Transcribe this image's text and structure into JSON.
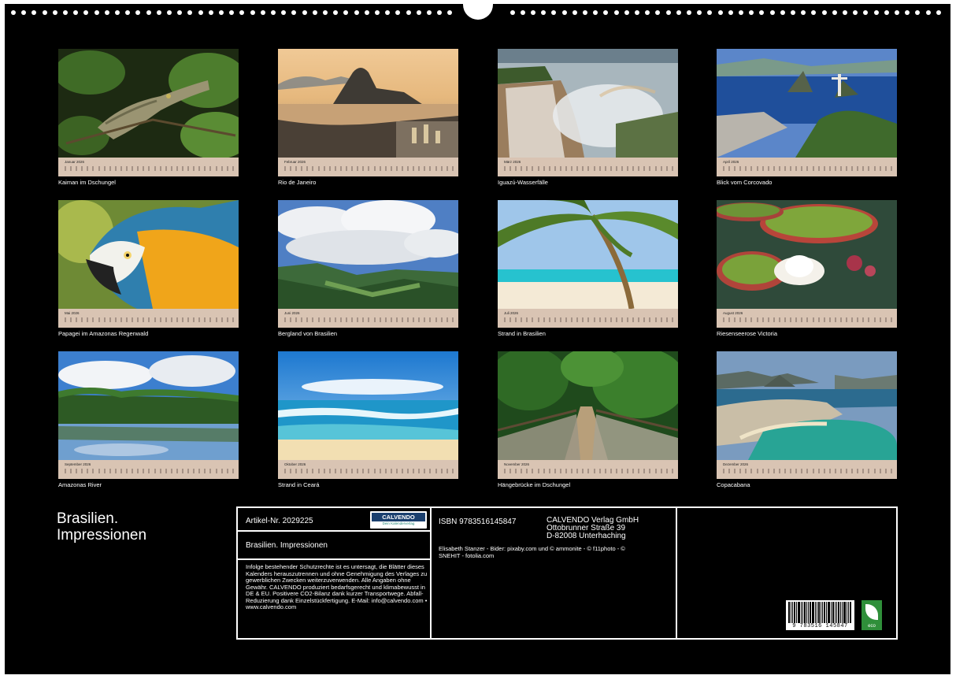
{
  "months": [
    {
      "month": "Januar",
      "year": "2026",
      "caption": "Kaiman im Dschungel"
    },
    {
      "month": "Februar",
      "year": "2026",
      "caption": "Rio de Janeiro"
    },
    {
      "month": "März",
      "year": "2026",
      "caption": "Iguazú-Wasserfälle"
    },
    {
      "month": "April",
      "year": "2026",
      "caption": "Blick vom Corcovado"
    },
    {
      "month": "Mai",
      "year": "2026",
      "caption": "Papagei im Amazonas Regenwald"
    },
    {
      "month": "Juni",
      "year": "2026",
      "caption": "Bergland von Brasilien"
    },
    {
      "month": "Juli",
      "year": "2026",
      "caption": "Strand in Brasilien"
    },
    {
      "month": "August",
      "year": "2026",
      "caption": "Riesenseerose Victoria"
    },
    {
      "month": "September",
      "year": "2026",
      "caption": "Amazonas River"
    },
    {
      "month": "Oktober",
      "year": "2026",
      "caption": "Strand in Ceará"
    },
    {
      "month": "November",
      "year": "2026",
      "caption": "Hängebrücke im Dschungel"
    },
    {
      "month": "Dezember",
      "year": "2026",
      "caption": "Copacabana"
    }
  ],
  "calendar_title_line1": "Brasilien.",
  "calendar_title_line2": "Impressionen",
  "info": {
    "article": "Artikel-Nr. 2029225",
    "logo_brand": "CALVENDO",
    "logo_tagline": "Dein Kalenderverlag",
    "title": "Brasilien. Impressionen",
    "legal": "Infolge bestehender Schutzrechte ist es untersagt, die Blätter dieses Kalenders herauszutrennen und ohne Genehmigung des Verlages zu gewerblichen Zwecken weiterzuverwenden. Alle Angaben ohne Gewähr. CALVENDO produziert bedarfsgerecht und klimabewusst in DE & EU. Positivere CO2-Bilanz dank kurzer Transportwege. Abfall-Reduzierung dank Einzelstückfertigung. E-Mail: info@calvendo.com • www.calvendo.com",
    "isbn": "ISBN 9783516145847",
    "publisher_line1": "CALVENDO Verlag GmbH",
    "publisher_line2": "Ottobrunner Straße 39",
    "publisher_line3": "D-82008 Unterhaching",
    "credits": "Elisabeth Stanzer - Bider: pixaby.com und © ammonite - © f11photo - © SNEHIT - fotolia.com",
    "barcode_number": "9 783516 145847",
    "eco_label": "eco"
  }
}
